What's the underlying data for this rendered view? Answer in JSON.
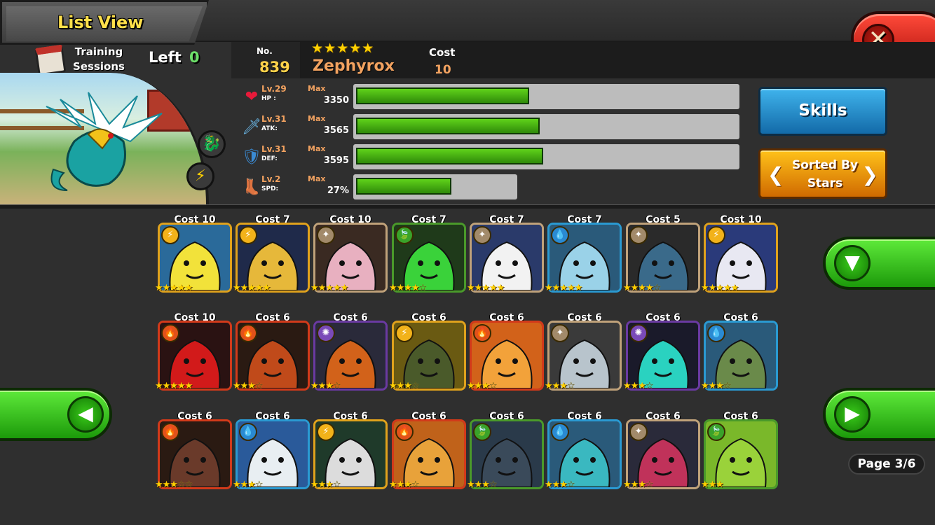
{
  "header": {
    "title": "List View",
    "close_icon": "close-x-icon"
  },
  "training": {
    "label": "Training Sessions",
    "left_label": "Left",
    "left_value": "0"
  },
  "monster": {
    "no_label": "No.",
    "number": "839",
    "stars": "★★★★★",
    "name": "Zephyrox",
    "cost_label": "Cost",
    "cost": "10",
    "element_badges": [
      "dragon-element-icon",
      "lightning-element-icon"
    ]
  },
  "stats": [
    {
      "icon": "heart-icon",
      "level": "Lv.29",
      "name": "HP :",
      "max": "Max",
      "value": "3350",
      "fill": 0.49,
      "track": "wide"
    },
    {
      "icon": "sword-icon",
      "level": "Lv.31",
      "name": "ATK:",
      "max": "Max",
      "value": "3565",
      "fill": 0.52,
      "track": "wide"
    },
    {
      "icon": "shield-icon",
      "level": "Lv.31",
      "name": "DEF:",
      "max": "Max",
      "value": "3595",
      "fill": 0.53,
      "track": "wide"
    },
    {
      "icon": "boot-icon",
      "level": "Lv.2",
      "name": "SPD:",
      "max": "Max",
      "value": "27%",
      "fill": 0.27,
      "track": "short"
    }
  ],
  "buttons": {
    "skills": "Skills",
    "sort_line1": "Sorted By",
    "sort_line2": "Stars",
    "filter_icon": "filter-icon",
    "prev_icon": "arrow-left-icon",
    "next_icon": "arrow-right-icon"
  },
  "page": "Page 3/6",
  "grid": [
    [
      {
        "cost": "Cost 10",
        "stars": 5,
        "max": 5,
        "elem": "lightning",
        "frame": "#e0a21c",
        "bg": "#2a6a9a",
        "fg": "#f2e23a"
      },
      {
        "cost": "Cost 7",
        "stars": 5,
        "max": 5,
        "elem": "lightning",
        "frame": "#e0a21c",
        "bg": "#1f2a4a",
        "fg": "#e6b83a"
      },
      {
        "cost": "Cost 10",
        "stars": 5,
        "max": 5,
        "elem": "neutral",
        "frame": "#c0a27a",
        "bg": "#3a2a22",
        "fg": "#e8b0c0"
      },
      {
        "cost": "Cost 7",
        "stars": 4,
        "max": 5,
        "elem": "nature",
        "frame": "#4a9a2a",
        "bg": "#1f3a1a",
        "fg": "#3ad23a"
      },
      {
        "cost": "Cost 7",
        "stars": 5,
        "max": 5,
        "elem": "neutral",
        "frame": "#c0a27a",
        "bg": "#2a3a6a",
        "fg": "#f2f2f2"
      },
      {
        "cost": "Cost 7",
        "stars": 5,
        "max": 5,
        "elem": "water",
        "frame": "#2a9ad2",
        "bg": "#2a5a7a",
        "fg": "#9ad2e8"
      },
      {
        "cost": "Cost 5",
        "stars": 4,
        "max": 5,
        "elem": "neutral",
        "frame": "#c0a27a",
        "bg": "#2a2a2a",
        "fg": "#3a6a8a"
      },
      {
        "cost": "Cost 10",
        "stars": 5,
        "max": 5,
        "elem": "lightning",
        "frame": "#e0a21c",
        "bg": "#2a3a7a",
        "fg": "#e8e8f2"
      }
    ],
    [
      {
        "cost": "Cost 10",
        "stars": 5,
        "max": 5,
        "elem": "fire",
        "frame": "#d23a1a",
        "bg": "#2a1212",
        "fg": "#d21a1a"
      },
      {
        "cost": "Cost 6",
        "stars": 3,
        "max": 4,
        "elem": "fire",
        "frame": "#d23a1a",
        "bg": "#2a1a12",
        "fg": "#c04a1a"
      },
      {
        "cost": "Cost 6",
        "stars": 3,
        "max": 4,
        "elem": "dark",
        "frame": "#6a3aa2",
        "bg": "#2a2a3a",
        "fg": "#d2621a"
      },
      {
        "cost": "Cost 6",
        "stars": 3,
        "max": 4,
        "elem": "lightning",
        "frame": "#e0a21c",
        "bg": "#6a5a12",
        "fg": "#4a5a2a"
      },
      {
        "cost": "Cost 6",
        "stars": 3,
        "max": 4,
        "elem": "fire",
        "frame": "#d23a1a",
        "bg": "#d2621a",
        "fg": "#f2a23a"
      },
      {
        "cost": "Cost 6",
        "stars": 3,
        "max": 4,
        "elem": "neutral",
        "frame": "#c0a27a",
        "bg": "#3a3a3a",
        "fg": "#b8c4cc"
      },
      {
        "cost": "Cost 6",
        "stars": 3,
        "max": 4,
        "elem": "dark",
        "frame": "#6a3aa2",
        "bg": "#1a1a2a",
        "fg": "#2ad2c0"
      },
      {
        "cost": "Cost 6",
        "stars": 3,
        "max": 4,
        "elem": "water",
        "frame": "#2a9ad2",
        "bg": "#2a5a7a",
        "fg": "#6a8a4a"
      }
    ],
    [
      {
        "cost": "Cost 6",
        "stars": 3,
        "max": 5,
        "elem": "fire",
        "frame": "#d23a1a",
        "bg": "#2a1a12",
        "fg": "#6a3a2a"
      },
      {
        "cost": "Cost 6",
        "stars": 3,
        "max": 4,
        "elem": "water",
        "frame": "#2a9ad2",
        "bg": "#2a5a9a",
        "fg": "#e8eef2"
      },
      {
        "cost": "Cost 6",
        "stars": 3,
        "max": 4,
        "elem": "lightning",
        "frame": "#e0a21c",
        "bg": "#1f3a2a",
        "fg": "#dcdcdc"
      },
      {
        "cost": "Cost 6",
        "stars": 3,
        "max": 4,
        "elem": "fire",
        "frame": "#d23a1a",
        "bg": "#c0621a",
        "fg": "#e8a23a"
      },
      {
        "cost": "Cost 6",
        "stars": 3,
        "max": 4,
        "elem": "nature",
        "frame": "#4a9a2a",
        "bg": "#2a3a4a",
        "fg": "#3a4a5a"
      },
      {
        "cost": "Cost 6",
        "stars": 3,
        "max": 4,
        "elem": "water",
        "frame": "#2a9ad2",
        "bg": "#2a5a7a",
        "fg": "#3ab8c0"
      },
      {
        "cost": "Cost 6",
        "stars": 3,
        "max": 4,
        "elem": "neutral",
        "frame": "#c0a27a",
        "bg": "#2a2a3a",
        "fg": "#c0325a"
      },
      {
        "cost": "Cost 6",
        "stars": 3,
        "max": 3,
        "elem": "nature",
        "frame": "#4a9a2a",
        "bg": "#7ab82a",
        "fg": "#9ad23a"
      }
    ]
  ]
}
